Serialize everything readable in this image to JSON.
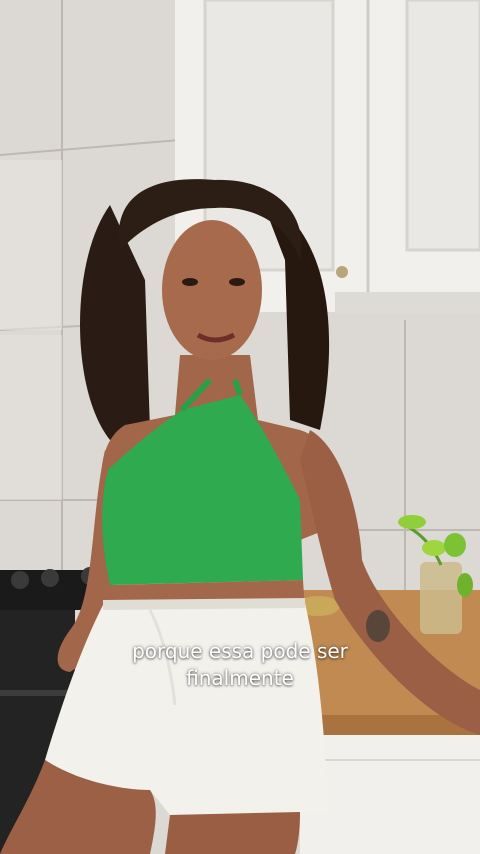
{
  "caption": {
    "line1": "porque essa pode ser",
    "line2": "finalmente"
  },
  "colors": {
    "top": "#2faa4f",
    "shorts": "#f2f1ec",
    "cabinet": "#f1f0ed",
    "counter": "#c08a52",
    "tile": "#e3e0dc"
  }
}
